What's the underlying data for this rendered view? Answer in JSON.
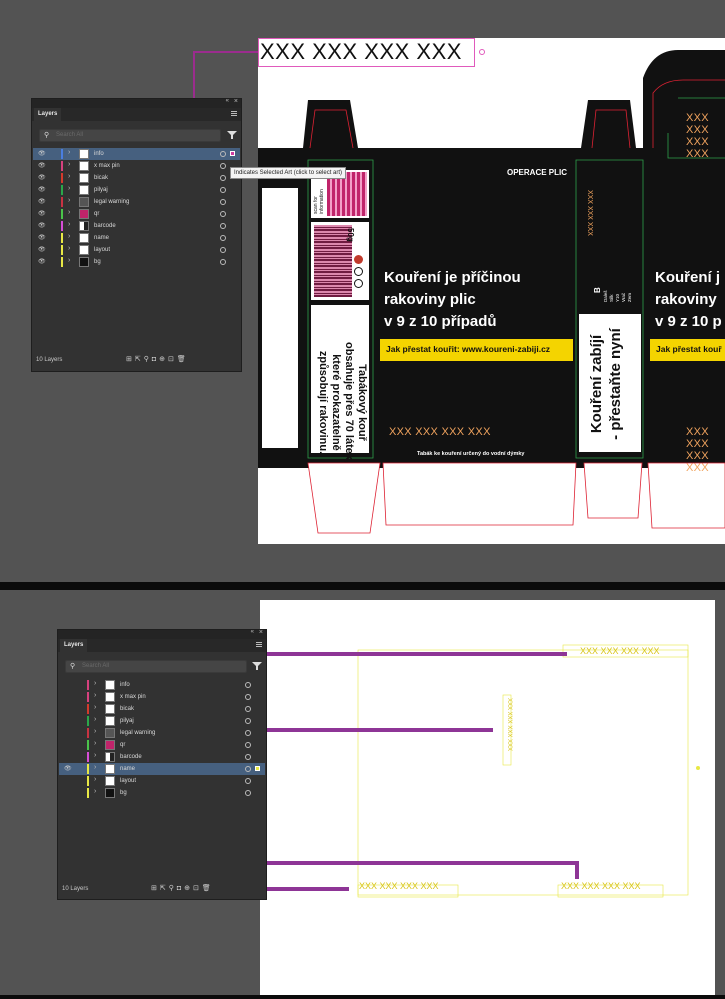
{
  "top": {
    "artboard_text": "XXX XXX XXX XXX",
    "tooltip": "Indicates Selected Art (click to select art)",
    "panel": {
      "tab": "Layers",
      "search_placeholder": "Search All",
      "status": "10 Layers",
      "selected_layer": "info",
      "layers": [
        {
          "name": "info",
          "color": "#4a7ee0"
        },
        {
          "name": "x max pin",
          "color": "#d6417e"
        },
        {
          "name": "bicak",
          "color": "#d33a2c"
        },
        {
          "name": "pilyaj",
          "color": "#2aa84a"
        },
        {
          "name": "legal warning",
          "color": "#c83342"
        },
        {
          "name": "qr",
          "color": "#4ac44a"
        },
        {
          "name": "barcode",
          "color": "#d64dd6"
        },
        {
          "name": "name",
          "color": "#e8e845"
        },
        {
          "name": "layout",
          "color": "#e8e845"
        },
        {
          "name": "bg",
          "color": "#e8e845"
        }
      ]
    },
    "pack": {
      "header_small": "OPERACE PLIC",
      "warning_main": [
        "Kouření je příčinou",
        "rakoviny plic",
        "v 9 z 10 případů"
      ],
      "warning_right": [
        "Kouření j",
        "rakoviny",
        "v 9 z 10 p"
      ],
      "yellow_left": "Jak přestat kouřit: www.koureni-zabiji.cz",
      "yellow_right": "Jak přestat kouř",
      "xxx": "XXX XXX XXX XXX",
      "footer": "Tabák ke kouření určený do vodní dýmky",
      "side_warning": [
        "Tabákový kouř",
        "obsahuje přes 70 látek,",
        "které prokazatelně",
        "způsobují rakovinu."
      ],
      "side_warning2": [
        "Kouření zabíjí",
        "- přestaňte nyní"
      ],
      "side_xxx_vertical": "XXX XXX XXX",
      "weight": "50g",
      "barcode_digits": "4 123456 789012",
      "qr_text": "scan for information",
      "b_letter": "B",
      "col_labels": [
        "Daleš",
        "Sílk",
        "Y10",
        "Vrač",
        "Zem"
      ]
    }
  },
  "bottom": {
    "panel": {
      "tab": "Layers",
      "search_placeholder": "Search All",
      "status": "10 Layers",
      "selected_layer": "name",
      "layers": [
        {
          "name": "info",
          "color": "#d6417e"
        },
        {
          "name": "x max pin",
          "color": "#d6417e"
        },
        {
          "name": "bicak",
          "color": "#d33a2c"
        },
        {
          "name": "pilyaj",
          "color": "#2aa84a"
        },
        {
          "name": "legal warning",
          "color": "#c83342"
        },
        {
          "name": "qr",
          "color": "#4ac44a"
        },
        {
          "name": "barcode",
          "color": "#d64dd6"
        },
        {
          "name": "name",
          "color": "#e8e845"
        },
        {
          "name": "layout",
          "color": "#e8e845"
        },
        {
          "name": "bg",
          "color": "#e8e845"
        }
      ]
    },
    "texts": [
      "XXX XXX XXX XXX",
      "XXX XXX XXX XXX",
      "XXX XXX XXX XXX",
      "XXX XXX XXX XXX"
    ]
  },
  "colors": {
    "annotation": "#9b2c8e",
    "selection": "#46607f",
    "warning_yellow": "#f4d400"
  }
}
